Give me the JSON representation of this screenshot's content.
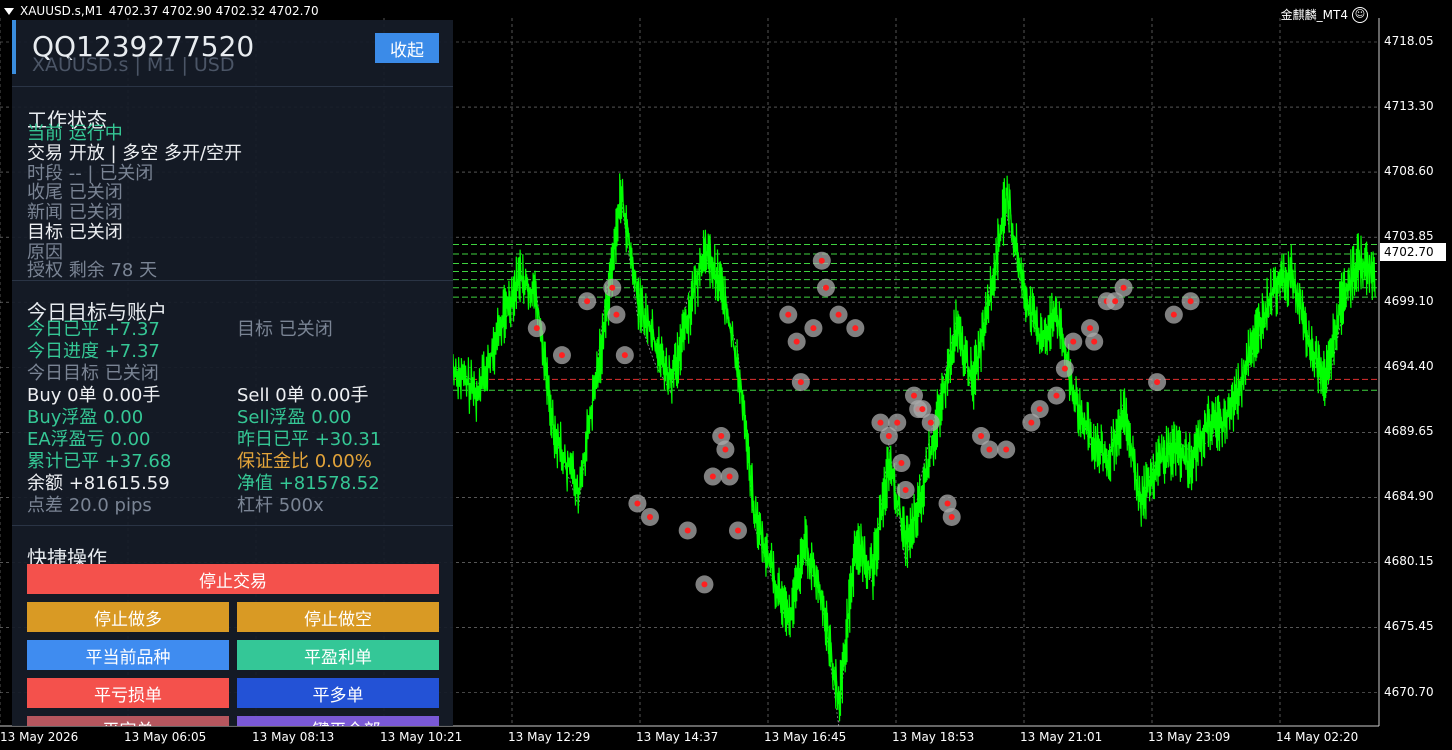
{
  "topbar": {
    "symbol": "XAUUSD.s,M1",
    "ohlc": "4702.37 4702.90 4702.32 4702.70"
  },
  "ea_name": "金麒麟_MT4",
  "chart_data": {
    "type": "line",
    "title": "XAUUSD.s,M1",
    "current_price": "4702.70",
    "y_ticks": [
      "4718.05",
      "4713.30",
      "4708.60",
      "4703.85",
      "4699.10",
      "4694.40",
      "4689.65",
      "4684.90",
      "4680.15",
      "4675.45",
      "4670.70"
    ],
    "x_ticks": [
      "13 May 2026",
      "13 May 06:05",
      "13 May 08:13",
      "13 May 10:21",
      "13 May 12:29",
      "13 May 14:37",
      "13 May 16:45",
      "13 May 18:53",
      "13 May 21:01",
      "13 May 23:09",
      "14 May 02:20"
    ],
    "ylim": [
      4668.5,
      4721.0
    ],
    "grid": true,
    "series_color": "#00ff00",
    "price_path": [
      [
        0,
        4695
      ],
      [
        3,
        4693
      ],
      [
        6,
        4699
      ],
      [
        8,
        4702
      ],
      [
        10,
        4700
      ],
      [
        12,
        4690
      ],
      [
        15,
        4686
      ],
      [
        18,
        4698
      ],
      [
        20,
        4708
      ],
      [
        22,
        4700
      ],
      [
        24,
        4697
      ],
      [
        26,
        4694
      ],
      [
        28,
        4699
      ],
      [
        30,
        4704
      ],
      [
        32,
        4701
      ],
      [
        34,
        4695
      ],
      [
        36,
        4684
      ],
      [
        38,
        4680
      ],
      [
        40,
        4676
      ],
      [
        42,
        4682
      ],
      [
        44,
        4678
      ],
      [
        46,
        4670
      ],
      [
        48,
        4682
      ],
      [
        50,
        4680
      ],
      [
        52,
        4688
      ],
      [
        54,
        4682
      ],
      [
        56,
        4686
      ],
      [
        58,
        4692
      ],
      [
        60,
        4698
      ],
      [
        62,
        4694
      ],
      [
        64,
        4700
      ],
      [
        66,
        4708
      ],
      [
        68,
        4701
      ],
      [
        70,
        4697
      ],
      [
        72,
        4699
      ],
      [
        74,
        4693
      ],
      [
        76,
        4690
      ],
      [
        78,
        4688
      ],
      [
        80,
        4692
      ],
      [
        82,
        4685
      ],
      [
        84,
        4688
      ],
      [
        86,
        4689
      ],
      [
        88,
        4688
      ],
      [
        90,
        4691
      ],
      [
        92,
        4691
      ],
      [
        94,
        4694
      ],
      [
        96,
        4698
      ],
      [
        98,
        4701
      ],
      [
        100,
        4702
      ],
      [
        102,
        4697
      ],
      [
        104,
        4694
      ],
      [
        106,
        4700
      ],
      [
        108,
        4703
      ],
      [
        110,
        4702
      ]
    ],
    "levels_green": [
      4704.2,
      4703.5,
      4702.8,
      4702.2,
      4701.6,
      4701.0,
      4700.3,
      4693.4
    ],
    "levels_red": [
      4694.2
    ]
  },
  "panel": {
    "title": "QQ1239277520",
    "subtitle": "XAUUSD.s  |  M1  |  USD",
    "collapse_label": "收起",
    "status": {
      "title": "工作状态",
      "current": "当前  运行中",
      "trade": "交易  开放  |  多空  多开/空开",
      "session": "时段  --  |  已关闭",
      "close": "收尾  已关闭",
      "news": "新闻  已关闭",
      "target": "目标  已关闭",
      "reason": "原因",
      "license": "授权  剩余 78 天"
    },
    "account": {
      "title": "今日目标与账户",
      "today_closed": "今日已平   +7.37",
      "target": "目标  已关闭",
      "today_progress": "今日进度   +7.37",
      "today_target": "今日目标  已关闭",
      "buy": "Buy  0单  0.00手",
      "sell": "Sell  0单  0.00手",
      "buy_float": "Buy浮盈  0.00",
      "sell_float": "Sell浮盈  0.00",
      "ea_float": "EA浮盈亏  0.00",
      "yesterday": "昨日已平   +30.31",
      "total": "累计已平   +37.68",
      "margin": "保证金比  0.00%",
      "balance": "余额   +81615.59",
      "equity": "净值   +81578.52",
      "spread": "点差  20.0 pips",
      "leverage": "杠杆  500x"
    },
    "quick": {
      "title": "快捷操作",
      "stop_trading": "停止交易",
      "stop_long": "停止做多",
      "stop_short": "停止做空",
      "close_symbol": "平当前品种",
      "close_profit": "平盈利单",
      "close_loss": "平亏损单",
      "close_long": "平多单",
      "close_short": "平空单",
      "close_all": "一键平全部"
    },
    "colors": {
      "accent": "#3b8be8",
      "red": "#f4514c",
      "orange": "#d99a24",
      "blue": "#3f8cf0",
      "teal": "#34c797",
      "navy": "#2352d6",
      "mauve": "#b5565e",
      "purple": "#7a59d6"
    }
  }
}
